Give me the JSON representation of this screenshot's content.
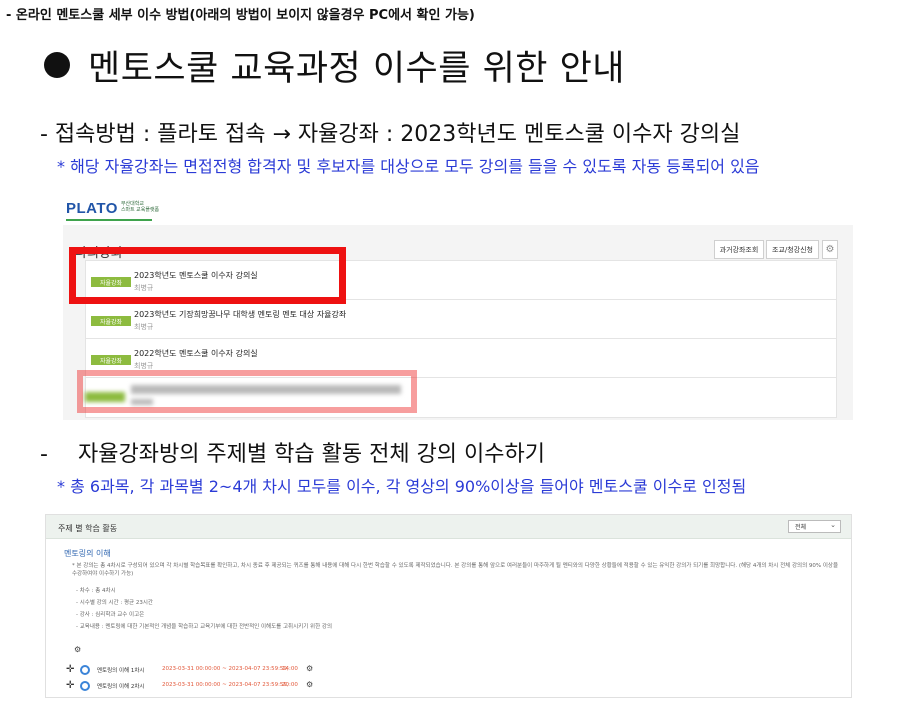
{
  "top_note": "- 온라인 멘토스쿨 세부 이수 방법(아래의 방법이 보이지 않을경우 PC에서 확인 가능)",
  "main_title": "멘토스쿨 교육과정 이수를 위한 안내",
  "section1": {
    "heading": "- 접속방법 : 플라토 접속 → 자율강좌 : 2023학년도 멘토스쿨 이수자 강의실",
    "note": "* 해당 자율강좌는 면접전형 합격자 및 후보자를 대상으로 모두 강의를 들을 수 있도록 자동 등록되어 있음"
  },
  "plato": {
    "logo": "PLATO",
    "logo_tag_line1": "부산대학교",
    "logo_tag_line2": "스마트 교육플랫폼",
    "panel_title": "나의강좌",
    "buttons": {
      "past": "과거강좌조회",
      "search": "조교/청강신청",
      "gear": "⚙"
    },
    "courses": [
      {
        "badge": "자율강좌",
        "title": "2023학년도 멘토스쿨 이수자 강의실",
        "prof": "최병규"
      },
      {
        "badge": "자율강좌",
        "title": "2023학년도 기장희망꿈나무 대학생 멘토링 멘토 대상 자율강좌",
        "prof": "최병규"
      },
      {
        "badge": "자율강좌",
        "title": "2022학년도 멘토스쿨 이수자 강의실",
        "prof": "최병규"
      }
    ]
  },
  "section2": {
    "dash": "-",
    "heading": "자율강좌방의 주제별 학습 활동 전체 강의 이수하기",
    "note": "* 총 6과목, 각 과목별 2~4개 차시 모두를 이수, 각 영상의 90%이상을 들어야 멘토스쿨 이수로 인정됨"
  },
  "activity": {
    "header_title": "주제 별 학습 활동",
    "select_value": "전체",
    "section_title": "멘토링의 이해",
    "description": "* 본 강의는 총 4차시로 구성되어 있으며 각 차시별 학습목표를 확인하고, 차시 종료 후 제공되는 퀴즈를 통해 내용에 대해 다시 한번 학습할 수 있도록 제작되었습니다. 본 강의를 통해 앞으로 여러분들이 마주하게 될 멘티와의 다양한 상황들에 적용할 수 있는 유익한 강의가 되기를 희망합니다. (해당 4개의 차시 전체 강의의 90% 이상을 수강하여야 이수하기 가능)",
    "info": [
      "- 차수 : 총 4차시",
      "- 시수별 강의 시간 : 평균 23시간",
      "- 강사 : 심리학과 교수 이고은",
      "- 교육내용 : 멘토링에 대한 기본적인 개념을 학습하고 교육기부에 대한 전반적인 이해도를 고취시키기 위한 강의"
    ],
    "lessons": [
      {
        "name": "멘토링의 이해 1차시",
        "period": "2023-03-31 00:00:00 ~ 2023-04-07 23:59:59,",
        "duration": "14:00"
      },
      {
        "name": "멘토링의 이해 2차시",
        "period": "2023-03-31 00:00:00 ~ 2023-04-07 23:59:59,",
        "duration": "20:00"
      }
    ]
  }
}
